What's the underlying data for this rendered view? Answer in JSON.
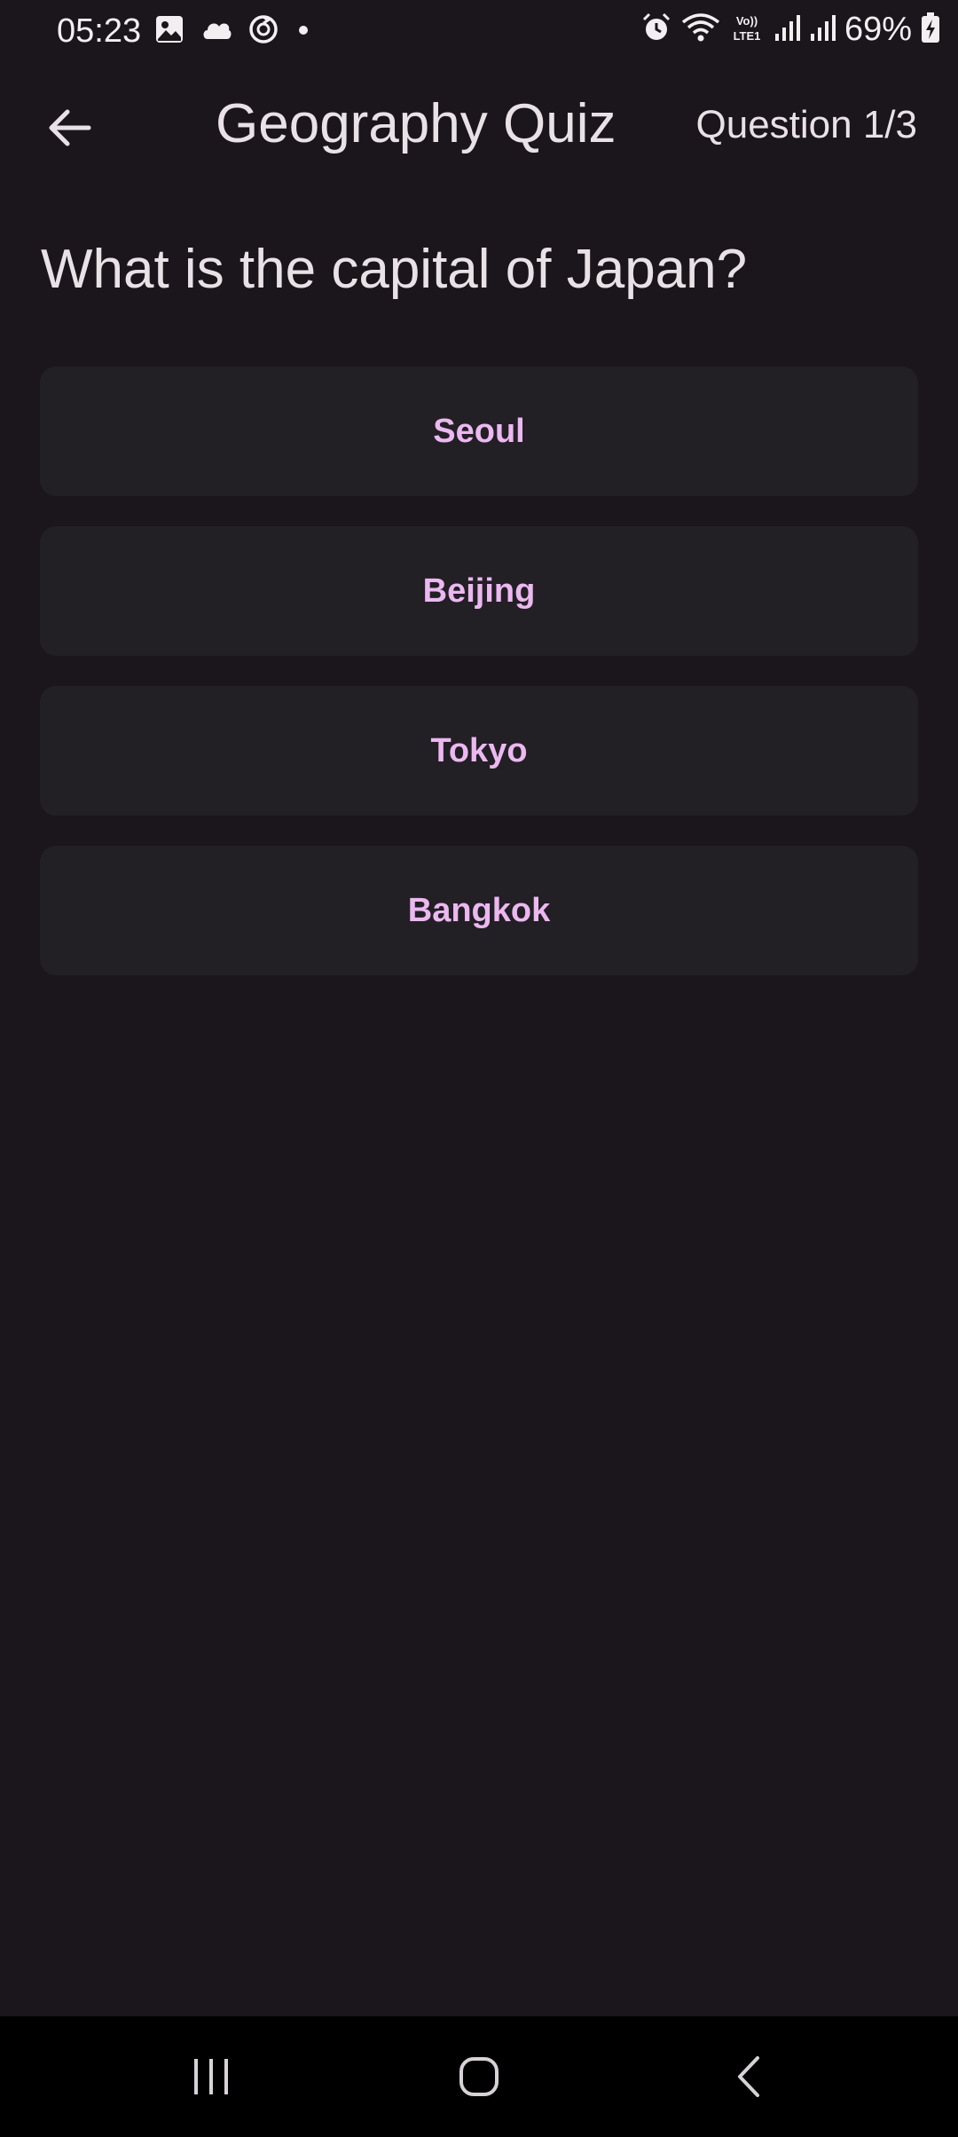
{
  "status_bar": {
    "time": "05:23",
    "battery": "69%",
    "left_icons": [
      "gallery-icon",
      "cloud-icon",
      "sync-icon",
      "dot-icon"
    ],
    "right_icons": [
      "alarm-icon",
      "wifi-icon",
      "volte-icon",
      "signal-icon",
      "signal-icon",
      "battery-icon"
    ]
  },
  "app_bar": {
    "title": "Geography Quiz",
    "counter": "Question 1/3",
    "back_icon": "arrow-back-icon"
  },
  "question": {
    "text": "What is the capital of Japan?"
  },
  "answers": [
    {
      "label": "Seoul"
    },
    {
      "label": "Beijing"
    },
    {
      "label": "Tokyo"
    },
    {
      "label": "Bangkok"
    }
  ],
  "nav_bar": {
    "buttons": [
      "recent-apps-icon",
      "home-icon",
      "back-icon"
    ]
  },
  "colors": {
    "background": "#1a161b",
    "surface": "#221f25",
    "accent_text": "#ebb8ef",
    "primary_text": "#e8e2e7"
  }
}
